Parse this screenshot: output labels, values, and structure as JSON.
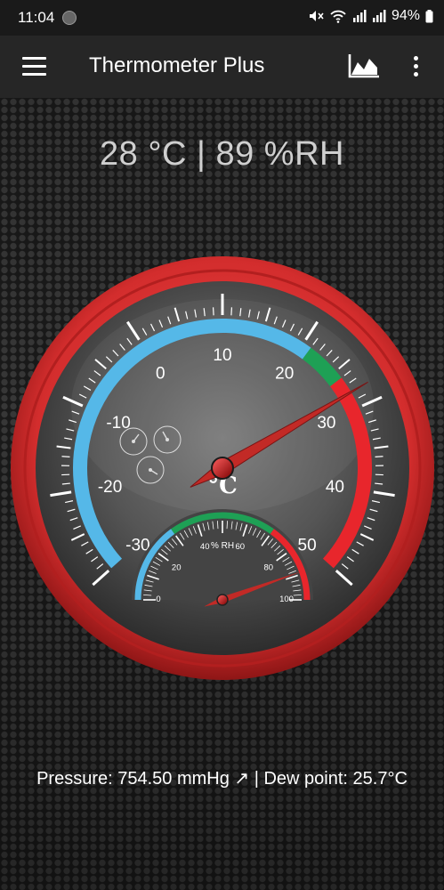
{
  "status_bar": {
    "time": "11:04",
    "battery": "94%",
    "icons": [
      "mute-icon",
      "wifi-icon",
      "signal-icon",
      "signal-icon",
      "battery-icon"
    ]
  },
  "app_bar": {
    "title": "Thermometer Plus",
    "icons": [
      "menu-icon",
      "area-chart-icon",
      "more-vert-icon"
    ]
  },
  "reading": {
    "text": "28 °C | 89 %RH",
    "temperature_c": 28,
    "humidity_rh": 89
  },
  "thermometer": {
    "unit": "°C",
    "scale_labels": [
      "-30",
      "-20",
      "-10",
      "0",
      "10",
      "20",
      "30",
      "40",
      "50"
    ],
    "min": -30,
    "max": 50,
    "value": 28,
    "zone_colors": {
      "cold": "#55b8e8",
      "comfort": "#1ea055",
      "hot": "#e8262c"
    }
  },
  "hygrometer": {
    "unit": "% RH",
    "scale_labels": [
      "0",
      "20",
      "40",
      "60",
      "80",
      "100"
    ],
    "min": 0,
    "max": 100,
    "value": 89
  },
  "footer": {
    "text": "Pressure: 754.50 mmHg ↗ | Dew point: 25.7°C"
  },
  "colors": {
    "bezel": "#d9302f",
    "dial": "#5a5a5a",
    "needle": "#c22a26"
  }
}
